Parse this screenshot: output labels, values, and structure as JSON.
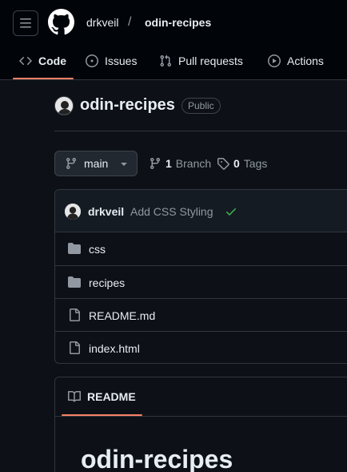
{
  "header": {
    "owner": "drkveil",
    "separator": "/",
    "repo": "odin-recipes"
  },
  "tabs": [
    {
      "label": "Code",
      "active": true
    },
    {
      "label": "Issues",
      "active": false
    },
    {
      "label": "Pull requests",
      "active": false
    },
    {
      "label": "Actions",
      "active": false
    }
  ],
  "repo": {
    "name": "odin-recipes",
    "visibility": "Public"
  },
  "branch": {
    "current": "main",
    "branch_count": "1",
    "branch_label": "Branch",
    "tag_count": "0",
    "tag_label": "Tags"
  },
  "commit": {
    "user": "drkveil",
    "message": "Add CSS Styling",
    "status": "success"
  },
  "files": [
    {
      "name": "css",
      "type": "folder"
    },
    {
      "name": "recipes",
      "type": "folder"
    },
    {
      "name": "README.md",
      "type": "file"
    },
    {
      "name": "index.html",
      "type": "file"
    }
  ],
  "readme": {
    "tab_label": "README",
    "heading": "odin-recipes"
  },
  "colors": {
    "accent": "#f78166",
    "success": "#3fb950",
    "background": "#0d1117",
    "header_bg": "#010409",
    "border": "#30363d"
  }
}
